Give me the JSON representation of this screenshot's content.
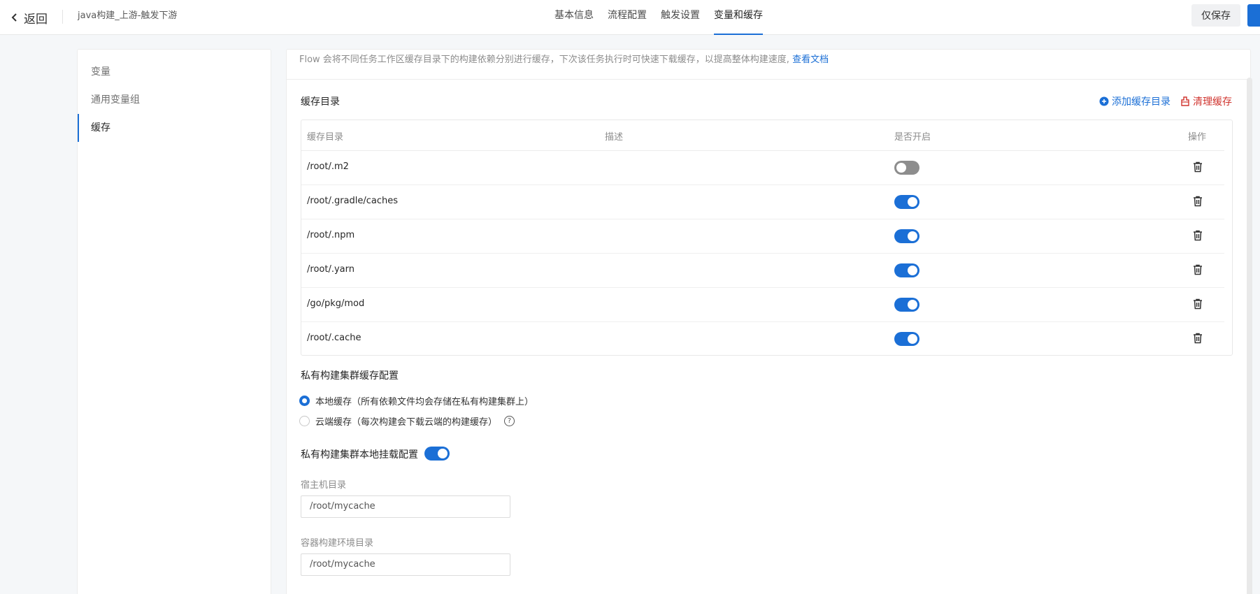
{
  "header": {
    "back_label": "返回",
    "pipeline_name": "java构建_上游-触发下游",
    "tabs": [
      {
        "label": "基本信息"
      },
      {
        "label": "流程配置"
      },
      {
        "label": "触发设置"
      },
      {
        "label": "变量和缓存",
        "active": true
      }
    ],
    "save_label": "仅保存"
  },
  "sidebar": {
    "items": [
      {
        "label": "变量"
      },
      {
        "label": "通用变量组"
      },
      {
        "label": "缓存",
        "active": true
      }
    ]
  },
  "main": {
    "notice_text": "Flow 会将不同任务工作区缓存目录下的构建依赖分别进行缓存，下次该任务执行时可快速下载缓存，以提高整体构建速度,",
    "notice_link": "查看文档",
    "cache_section_title": "缓存目录",
    "add_cache_label": "添加缓存目录",
    "clear_cache_label": "清理缓存",
    "table": {
      "headers": [
        "缓存目录",
        "描述",
        "是否开启",
        "操作"
      ],
      "rows": [
        {
          "dir": "/root/.m2",
          "desc": "",
          "enabled": false
        },
        {
          "dir": "/root/.gradle/caches",
          "desc": "",
          "enabled": true
        },
        {
          "dir": "/root/.npm",
          "desc": "",
          "enabled": true
        },
        {
          "dir": "/root/.yarn",
          "desc": "",
          "enabled": true
        },
        {
          "dir": "/go/pkg/mod",
          "desc": "",
          "enabled": true
        },
        {
          "dir": "/root/.cache",
          "desc": "",
          "enabled": true
        }
      ]
    },
    "private_cluster_title": "私有构建集群缓存配置",
    "radio_local": "本地缓存（所有依赖文件均会存储在私有构建集群上）",
    "radio_cloud": "云端缓存（每次构建会下载云端的构建缓存）",
    "local_mount_title": "私有构建集群本地挂载配置",
    "local_mount_enabled": true,
    "host_dir_label": "宿主机目录",
    "host_dir_value": "/root/mycache",
    "container_dir_label": "容器构建环境目录",
    "container_dir_value": "/root/mycache"
  },
  "colors": {
    "accent": "#1b6fd6",
    "danger": "#d0352f",
    "toggle_off": "#8d8d8d"
  }
}
